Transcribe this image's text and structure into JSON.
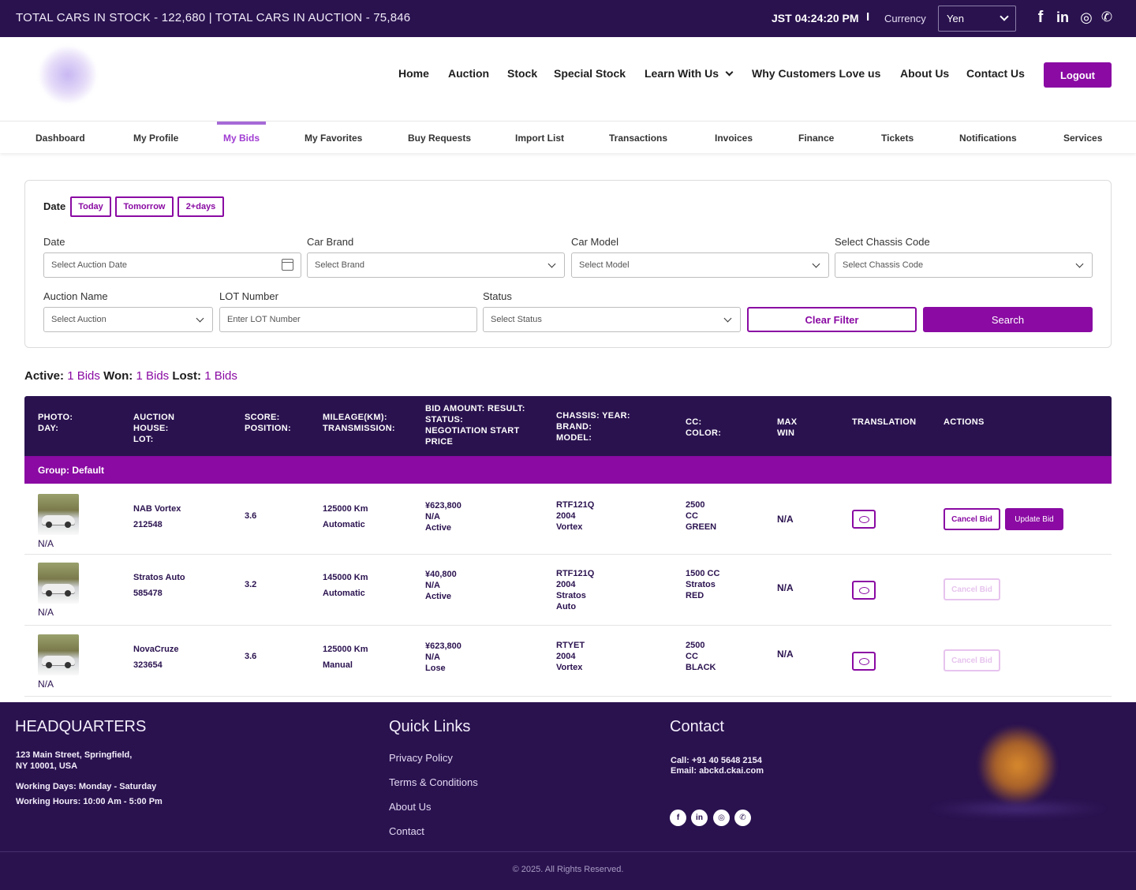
{
  "topbar": {
    "stock_text": "TOTAL CARS IN STOCK - 122,680 | TOTAL CARS IN AUCTION - 75,846",
    "time": "JST 04:24:20 PM",
    "separator": "I",
    "currency_label": "Currency",
    "currency_value": "Yen",
    "social": [
      "f",
      "in",
      "◎",
      "✆"
    ]
  },
  "nav": {
    "home": "Home",
    "auction": "Auction",
    "stock": "Stock",
    "special_stock": "Special Stock",
    "learn": "Learn With Us",
    "why": "Why Customers Love us",
    "about": "About Us",
    "contact": "Contact Us",
    "logout": "Logout"
  },
  "subnav": {
    "dashboard": "Dashboard",
    "profile": "My Profile",
    "bids": "My Bids",
    "favorites": "My Favorites",
    "buy_requests": "Buy Requests",
    "import_list": "Import List",
    "transactions": "Transactions",
    "invoices": "Invoices",
    "finance": "Finance",
    "tickets": "Tickets",
    "notifications": "Notifications",
    "services": "Services"
  },
  "filter": {
    "date_label_bold": "Date",
    "chips": [
      "Today",
      "Tomorrow",
      "2+days"
    ],
    "date_label": "Date",
    "date_placeholder": "Select Auction Date",
    "brand_label": "Car Brand",
    "brand_placeholder": "Select Brand",
    "model_label": "Car Model",
    "model_placeholder": "Select Model",
    "chassis_label": "Select Chassis Code",
    "chassis_placeholder": "Select Chassis Code",
    "auction_label": "Auction Name",
    "auction_placeholder": "Select Auction",
    "lot_label": "LOT Number",
    "lot_placeholder": "Enter LOT Number",
    "status_label": "Status",
    "status_placeholder": "Select Status",
    "clear": "Clear Filter",
    "search": "Search"
  },
  "summary": {
    "active_label": "Active:",
    "active_value": "1 Bids",
    "won_label": "Won:",
    "won_value": "1 Bids",
    "lost_label": "Lost:",
    "lost_value": "1 Bids"
  },
  "table": {
    "headers": {
      "photo": "PHOTO:\nDAY:",
      "auction": "AUCTION\nHOUSE:\nLOT:",
      "score": "SCORE:\nPOSITION:",
      "mileage": "MILEAGE(KM):\nTRANSMISSION:",
      "bid": "BID AMOUNT: RESULT:\nSTATUS:\nNEGOTIATION START\nPRICE",
      "chassis": "CHASSIS: YEAR:\nBRAND:\nMODEL:",
      "cc": "CC:\nCOLOR:",
      "maxwin": "MAX\nWIN",
      "translation": "TRANSLATION",
      "actions": "ACTIONS"
    },
    "group": "Group: Default",
    "rows": [
      {
        "day": "N/A",
        "house": "NAB Vortex",
        "lot": "212548",
        "score": "3.6",
        "mileage": "125000 Km",
        "transmission": "Automatic",
        "bid": "¥623,800",
        "result": "N/A",
        "status": "Active",
        "chassis": "RTF121Q",
        "year": "2004",
        "model": "Vortex",
        "cc": "2500\nCC\nGREEN",
        "maxwin": "N/A",
        "cancel": "Cancel Bid",
        "update": "Update Bid"
      },
      {
        "day": "N/A",
        "house": "Stratos Auto",
        "lot": "585478",
        "score": "3.2",
        "mileage": "145000 Km",
        "transmission": "Automatic",
        "bid": "¥40,800",
        "result": "N/A",
        "status": "Active",
        "chassis": "RTF121Q",
        "year": "2004",
        "model": "Stratos\nAuto",
        "cc": "1500 CC\nStratos\nRED",
        "maxwin": "N/A",
        "cancel": "Cancel Bid"
      },
      {
        "day": "N/A",
        "house": "NovaCruze",
        "lot": "323654",
        "score": "3.6",
        "mileage": "125000 Km",
        "transmission": "Manual",
        "bid": "¥623,800",
        "result": "N/A",
        "status": "Lose",
        "chassis": "RTYET",
        "year": "2004",
        "model": "Vortex",
        "cc": "2500\nCC\nBLACK",
        "maxwin": "N/A",
        "cancel": "Cancel Bid"
      }
    ]
  },
  "footer": {
    "hq_title": "HEADQUARTERS",
    "address": "123 Main Street, Springfield,\nNY 10001, USA",
    "days": "Working Days: Monday - Saturday",
    "hours": "Working Hours: 10:00 Am - 5:00 Pm",
    "quick_title": "Quick Links",
    "links": [
      "Privacy Policy",
      "Terms & Conditions",
      "About Us",
      "Contact"
    ],
    "contact_title": "Contact",
    "call": "Call: +91 40 5648 2154",
    "email": "Email: abckd.ckai.com",
    "social": [
      "f",
      "in",
      "◎",
      "✆"
    ],
    "copyright": "© 2025. All Rights Reserved."
  },
  "colors": {
    "navy": "#2a124f",
    "accent": "#8a0aa3"
  }
}
